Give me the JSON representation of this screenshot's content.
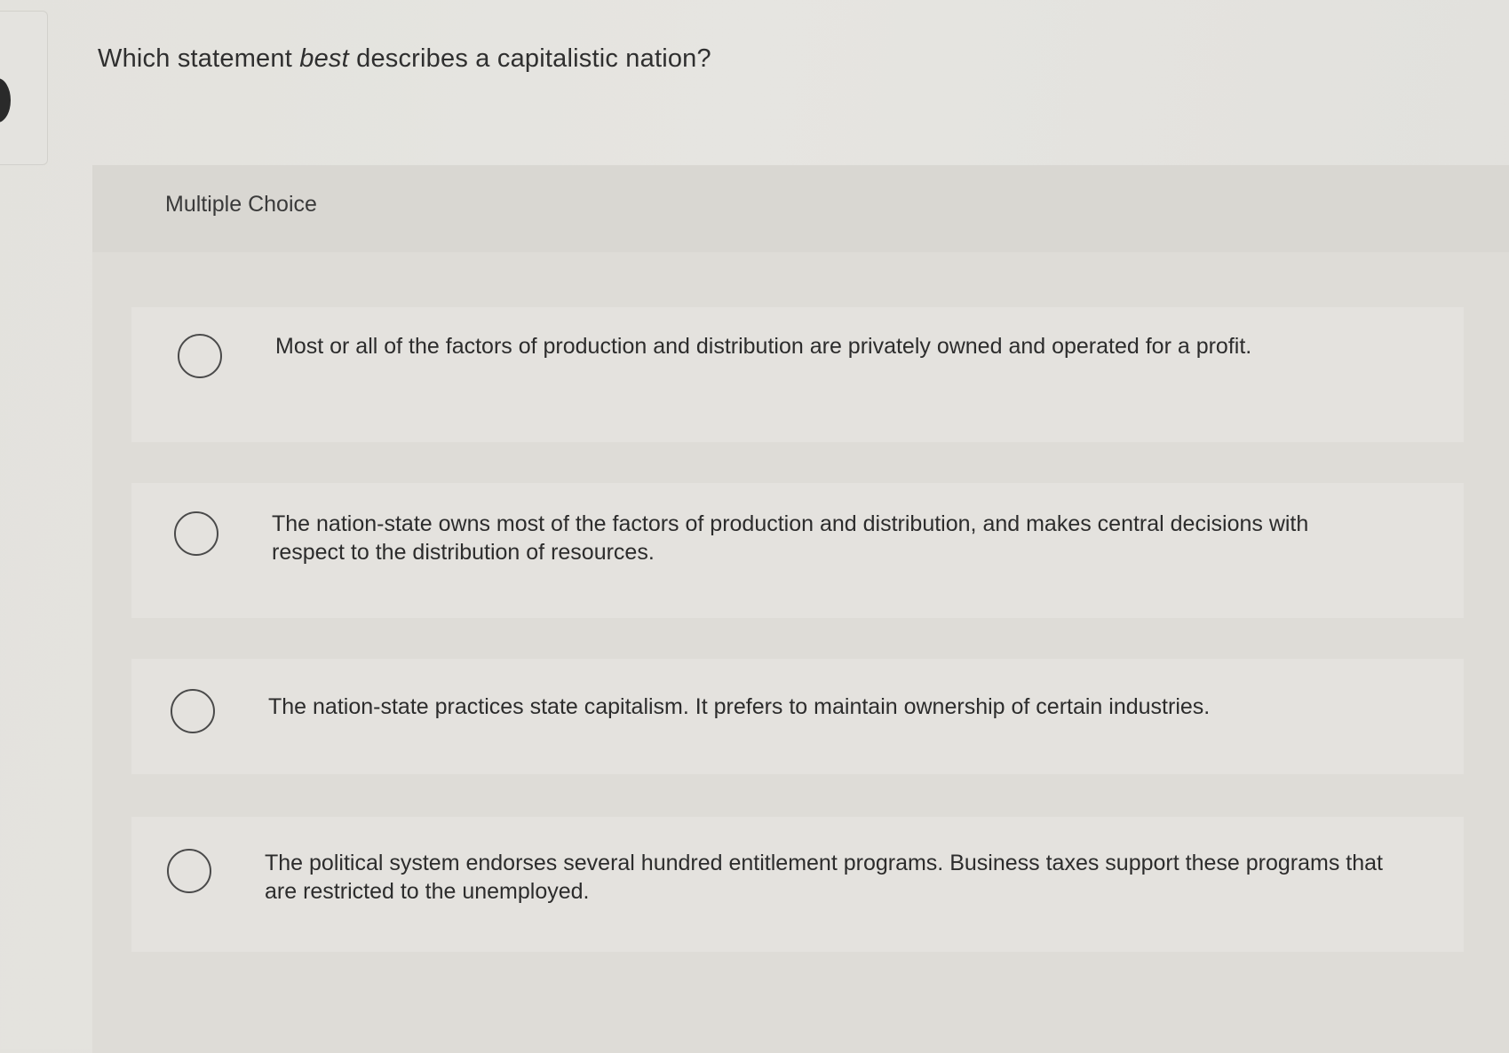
{
  "question": {
    "prefix": "Which statement ",
    "emphasis": "best",
    "suffix": " describes a capitalistic nation?"
  },
  "quiz": {
    "type_label": "Multiple Choice",
    "options": [
      {
        "label": "Most or all of the factors of production and distribution are privately owned and operated for a profit.",
        "selected": false
      },
      {
        "label": "The nation-state owns most of the factors of production and distribution, and makes central decisions with respect to the distribution of resources.",
        "selected": false
      },
      {
        "label": "The nation-state practices state capitalism. It prefers to maintain ownership of certain industries.",
        "selected": false
      },
      {
        "label": "The political system endorses several hundred entitlement programs. Business taxes support these programs that are restricted to the unemployed.",
        "selected": false
      }
    ]
  }
}
